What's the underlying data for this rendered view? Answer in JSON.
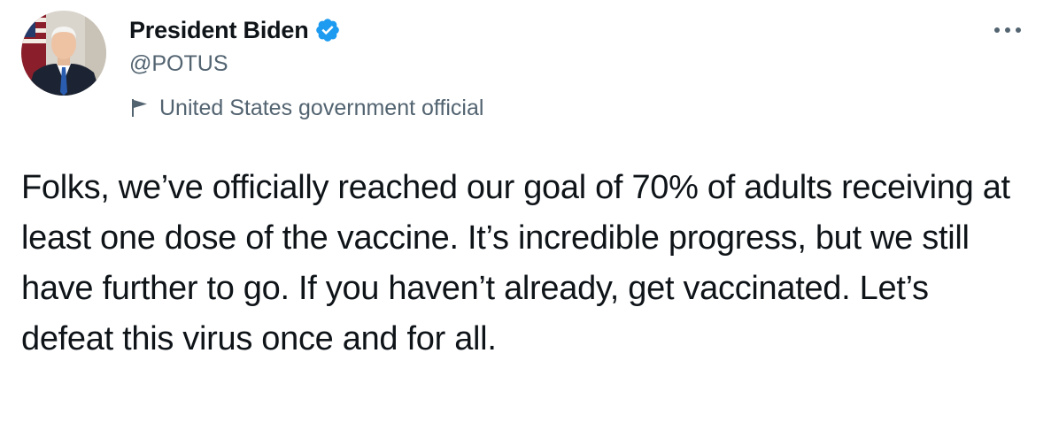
{
  "author": {
    "display_name": "President Biden",
    "handle": "@POTUS",
    "verified": true,
    "label": "United States government official",
    "avatar_icon": "profile-photo"
  },
  "tweet": {
    "text": "Folks, we’ve officially reached our goal of 70% of adults receiving at least one dose of the vaccine. It’s incredible progress, but we still have further to go. If you haven’t already, get vaccinated. Let’s defeat this virus once and for all."
  },
  "icons": {
    "verified": "verified-badge-icon",
    "label": "flag-icon",
    "more": "more-options-icon"
  },
  "colors": {
    "primary_text": "#0f1419",
    "secondary_text": "#536471",
    "verified_blue": "#1d9bf0",
    "background": "#ffffff"
  }
}
